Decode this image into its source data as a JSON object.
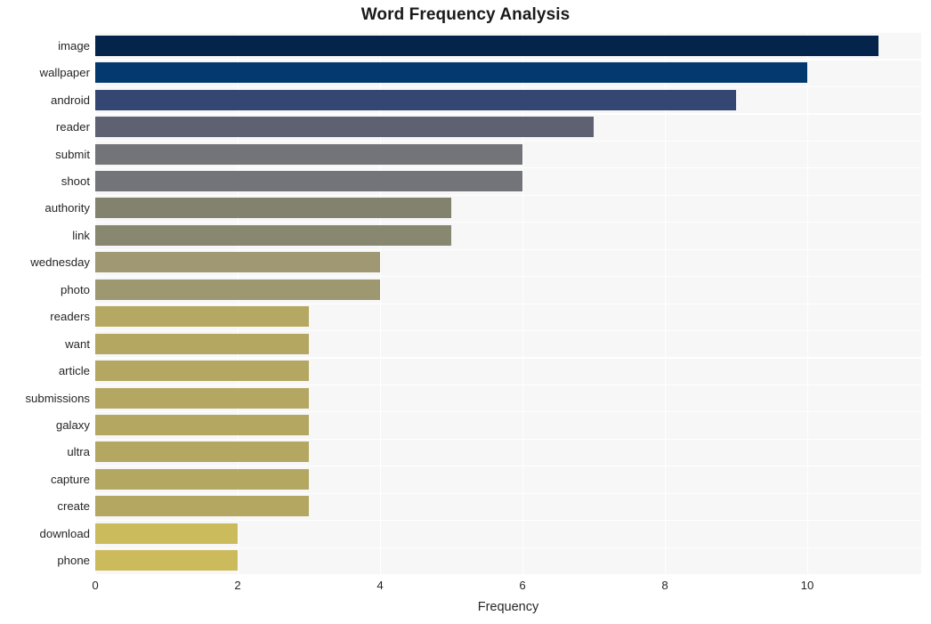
{
  "chart_data": {
    "type": "bar",
    "orientation": "horizontal",
    "title": "Word Frequency Analysis",
    "xlabel": "Frequency",
    "ylabel": "",
    "categories": [
      "image",
      "wallpaper",
      "android",
      "reader",
      "submit",
      "shoot",
      "authority",
      "link",
      "wednesday",
      "photo",
      "readers",
      "want",
      "article",
      "submissions",
      "galaxy",
      "ultra",
      "capture",
      "create",
      "download",
      "phone"
    ],
    "values": [
      11,
      10,
      9,
      7,
      6,
      6,
      5,
      5,
      4,
      4,
      3,
      3,
      3,
      3,
      3,
      3,
      3,
      3,
      2,
      2
    ],
    "bar_colors": [
      "#04244c",
      "#03396e",
      "#344773",
      "#5d6172",
      "#727479",
      "#737479",
      "#83826f",
      "#88876f",
      "#9f9872",
      "#9e9871",
      "#b4a862",
      "#b3a762",
      "#b3a762",
      "#b3a761",
      "#b3a761",
      "#b3a761",
      "#b3a761",
      "#b3a761",
      "#ccbb5c",
      "#ccbb5c"
    ],
    "xticks": [
      0,
      2,
      4,
      6,
      8,
      10
    ],
    "xlim": [
      0,
      11.6
    ],
    "grid": true,
    "grid_color": "#ffffff",
    "plot_background": "#f7f7f7",
    "figure_background": "#ffffff",
    "legend": null,
    "points": [
      {
        "label": "image",
        "value": 11
      },
      {
        "label": "wallpaper",
        "value": 10
      },
      {
        "label": "android",
        "value": 9
      },
      {
        "label": "reader",
        "value": 7
      },
      {
        "label": "submit",
        "value": 6
      },
      {
        "label": "shoot",
        "value": 6
      },
      {
        "label": "authority",
        "value": 5
      },
      {
        "label": "link",
        "value": 5
      },
      {
        "label": "wednesday",
        "value": 4
      },
      {
        "label": "photo",
        "value": 4
      },
      {
        "label": "readers",
        "value": 3
      },
      {
        "label": "want",
        "value": 3
      },
      {
        "label": "article",
        "value": 3
      },
      {
        "label": "submissions",
        "value": 3
      },
      {
        "label": "galaxy",
        "value": 3
      },
      {
        "label": "ultra",
        "value": 3
      },
      {
        "label": "capture",
        "value": 3
      },
      {
        "label": "create",
        "value": 3
      },
      {
        "label": "download",
        "value": 2
      },
      {
        "label": "phone",
        "value": 2
      }
    ]
  }
}
